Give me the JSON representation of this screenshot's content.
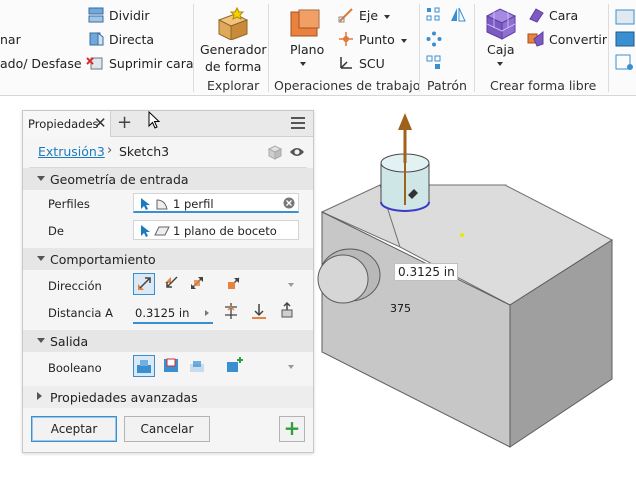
{
  "ribbon": {
    "partial_left_1": "nar",
    "partial_left_2": "ado/ Desfase",
    "dividir": "Dividir",
    "directa": "Directa",
    "suprimir_cara": "Suprimir cara",
    "generador_line1": "Generador",
    "generador_line2": "de forma",
    "plano": "Plano",
    "eje": "Eje",
    "punto": "Punto",
    "scu": "SCU",
    "caja": "Caja",
    "cara": "Cara",
    "convertir": "Convertir",
    "groups": {
      "explorar": "Explorar",
      "operaciones": "Operaciones de trabajo",
      "patron": "Patrón",
      "crear_forma_libre": "Crear forma libre"
    },
    "colors": {
      "accent": "#3a8fd1",
      "orange": "#e07a3a",
      "purple": "#7b5bc0"
    }
  },
  "panel": {
    "tab_label": "Propiedades",
    "breadcrumb_link": "Extrusión3",
    "breadcrumb_current": "Sketch3",
    "sections": {
      "geometria": "Geometría de entrada",
      "comportamiento": "Comportamiento",
      "salida": "Salida",
      "avanzadas": "Propiedades avanzadas"
    },
    "rows": {
      "perfiles_label": "Perfiles",
      "perfiles_value": "1 perfil",
      "de_label": "De",
      "de_value": "1 plano de boceto",
      "direccion_label": "Dirección",
      "distancia_label": "Distancia A",
      "distancia_value": "0.3125 in",
      "booleano_label": "Booleano"
    },
    "buttons": {
      "ok": "Aceptar",
      "cancel": "Cancelar",
      "plus": "+"
    }
  },
  "viewport": {
    "dimension_value": "0.3125 in",
    "dimension_partial": "375"
  }
}
